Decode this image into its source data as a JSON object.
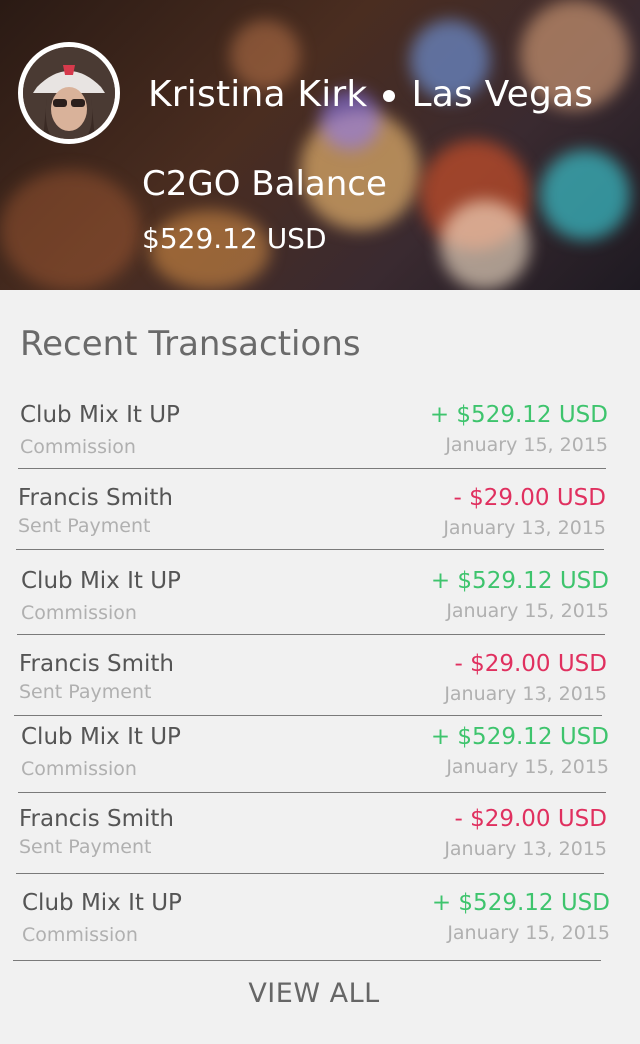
{
  "profile": {
    "name": "Kristina Kirk",
    "location": "Las Vegas"
  },
  "balance": {
    "title": "C2GO Balance",
    "amount": "$529.12 USD"
  },
  "transactions_section": {
    "title": "Recent Transactions",
    "items": [
      {
        "name": "Club Mix It UP",
        "type": "Commission",
        "amount": "+ $529.12 USD",
        "date": "January 15, 2015",
        "direction": "credit"
      },
      {
        "name": "Francis Smith",
        "type": "Sent Payment",
        "amount": "- $29.00 USD",
        "date": "January 13, 2015",
        "direction": "debit"
      },
      {
        "name": "Club Mix It UP",
        "type": "Commission",
        "amount": "+ $529.12 USD",
        "date": "January 15, 2015",
        "direction": "credit"
      },
      {
        "name": "Francis Smith",
        "type": "Sent Payment",
        "amount": "- $29.00 USD",
        "date": "January 13, 2015",
        "direction": "debit"
      },
      {
        "name": "Club Mix It UP",
        "type": "Commission",
        "amount": "+ $529.12 USD",
        "date": "January 15, 2015",
        "direction": "credit"
      },
      {
        "name": "Francis Smith",
        "type": "Sent Payment",
        "amount": "- $29.00 USD",
        "date": "January 13, 2015",
        "direction": "debit"
      },
      {
        "name": "Club Mix It UP",
        "type": "Commission",
        "amount": "+ $529.12 USD",
        "date": "January 15, 2015",
        "direction": "credit"
      }
    ],
    "view_all_label": "VIEW ALL"
  },
  "colors": {
    "credit": "#3ec46d",
    "debit": "#e0305f",
    "background": "#f1f1f1"
  },
  "icons": {
    "avatar": "user-avatar-photo",
    "separator": "bullet-dot"
  }
}
